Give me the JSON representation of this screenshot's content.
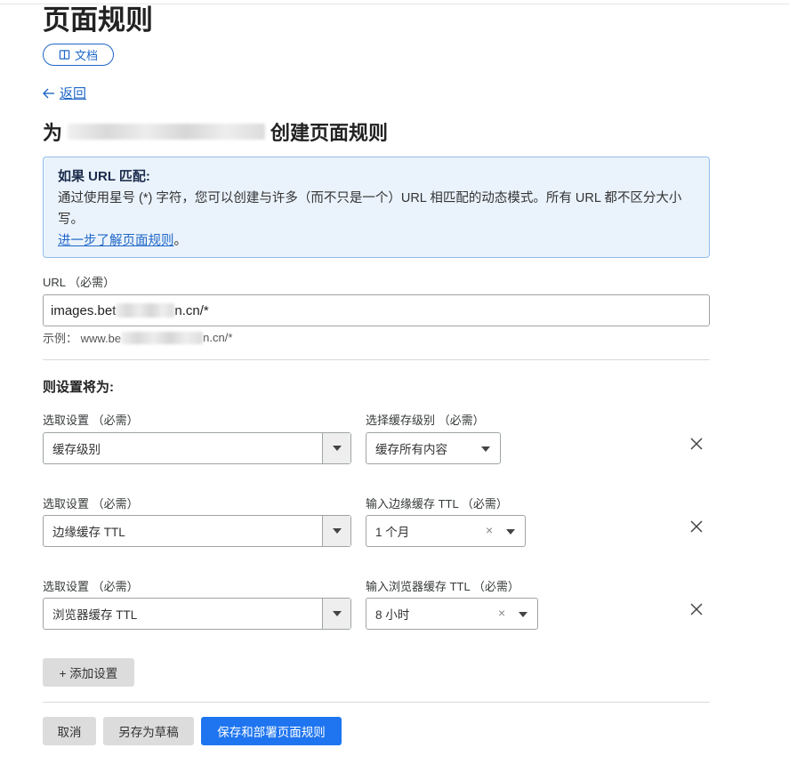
{
  "page": {
    "title": "页面规则"
  },
  "doc_button": {
    "label": "文档"
  },
  "back": {
    "label": "返回"
  },
  "create": {
    "prefix": "为",
    "suffix": "创建页面规则"
  },
  "info": {
    "heading": "如果 URL 匹配:",
    "body": "通过使用星号 (*) 字符，您可以创建与许多（而不只是一个）URL 相匹配的动态模式。所有 URL 都不区分大小写。",
    "link": "进一步了解页面规则",
    "link_suffix": "。"
  },
  "url": {
    "label": "URL （必需）",
    "value_prefix": "images.bet",
    "value_suffix": "n.cn/*",
    "example_prefix": "示例：  www.be",
    "example_suffix": "n.cn/*"
  },
  "settings": {
    "heading": "则设置将为:",
    "rows": [
      {
        "left_label": "选取设置 （必需）",
        "left_value": "缓存级别",
        "right_label": "选择缓存级别 （必需）",
        "right_value": "缓存所有内容"
      },
      {
        "left_label": "选取设置 （必需）",
        "left_value": "边缘缓存 TTL",
        "right_label": "输入边缘缓存 TTL （必需）",
        "right_value": "1 个月"
      },
      {
        "left_label": "选取设置 （必需）",
        "left_value": "浏览器缓存 TTL",
        "right_label": "输入浏览器缓存 TTL （必需）",
        "right_value": "8 小时"
      }
    ],
    "clear_glyph": "×",
    "add_label": "+ 添加设置"
  },
  "actions": {
    "cancel": "取消",
    "save_draft": "另存为草稿",
    "save_deploy": "保存和部署页面规则"
  },
  "colors": {
    "accent": "#1f67c8",
    "primary_button": "#1f75f0",
    "info_bg": "#eaf3fc"
  }
}
